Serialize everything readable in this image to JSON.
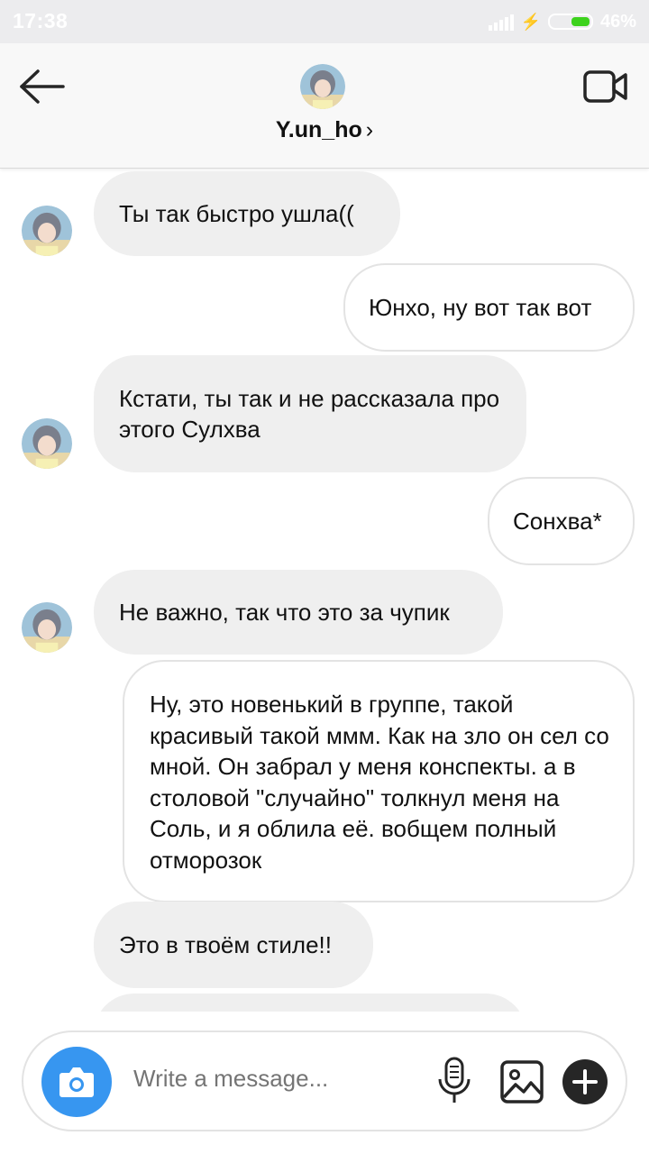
{
  "status_bar": {
    "time": "17:38",
    "battery_percent": "46%",
    "battery_level": 0.46
  },
  "header": {
    "username": "Y.un_ho",
    "chevron": "›",
    "icons": [
      "back-arrow-icon",
      "video-call-icon",
      "avatar"
    ]
  },
  "messages": [
    {
      "direction": "in",
      "text": "Ты так быстро ушла(("
    },
    {
      "direction": "out",
      "text": "Юнхо, ну вот так вот"
    },
    {
      "direction": "in",
      "text": "Кстати, ты так и не рассказала про этого Сулхва"
    },
    {
      "direction": "out",
      "text": "Сонхва*"
    },
    {
      "direction": "in",
      "text": "Не важно, так что это за чупик"
    },
    {
      "direction": "out",
      "text": "Ну, это новенький в группе, такой красивый такой ммм. Как на зло он сел со мной. Он забрал у меня конспекты. а в столовой \"случайно\" толкнул меня на Соль, и я облила её. вобщем полный отморозок"
    },
    {
      "direction": "in",
      "text": "Это в твоём стиле!!"
    }
  ],
  "composer": {
    "placeholder": "Write a message...",
    "icons": [
      "camera-icon",
      "microphone-icon",
      "gallery-icon",
      "plus-icon"
    ]
  },
  "colors": {
    "accent_blue": "#3796f0",
    "incoming_bubble": "#efefef",
    "outgoing_border": "#e3e3e3",
    "battery_green": "#3dd21d"
  }
}
